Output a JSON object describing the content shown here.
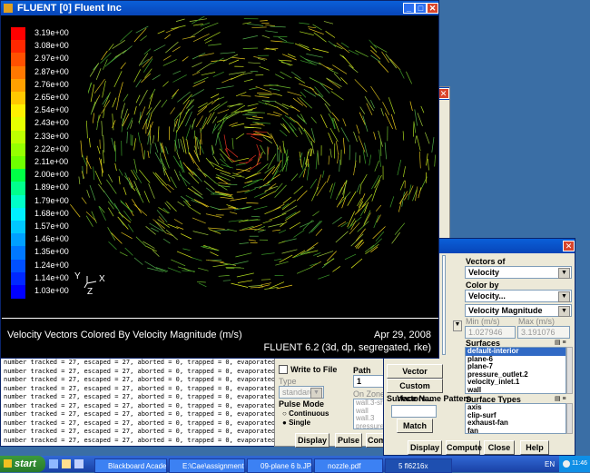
{
  "fluent_window": {
    "title": "FLUENT [0] Fluent Inc",
    "legend": [
      "3.19e+00",
      "3.08e+00",
      "2.97e+00",
      "2.87e+00",
      "2.76e+00",
      "2.65e+00",
      "2.54e+00",
      "2.43e+00",
      "2.33e+00",
      "2.22e+00",
      "2.11e+00",
      "2.00e+00",
      "1.89e+00",
      "1.79e+00",
      "1.68e+00",
      "1.57e+00",
      "1.46e+00",
      "1.35e+00",
      "1.24e+00",
      "1.14e+00",
      "1.03e+00"
    ],
    "legend_colors": [
      "#ff0000",
      "#ff2800",
      "#ff5000",
      "#ff7800",
      "#ffa000",
      "#ffc800",
      "#fff000",
      "#e6ff00",
      "#beff00",
      "#96ff00",
      "#6eff00",
      "#00ff46",
      "#00ff8c",
      "#00ffc8",
      "#00f0ff",
      "#00c8ff",
      "#00a0ff",
      "#0078ff",
      "#0050ff",
      "#0028ff",
      "#0000ff"
    ],
    "axis_y": "Y",
    "axis_x": "X",
    "axis_z": "Z",
    "caption": "Velocity Vectors Colored By Velocity Magnitude (m/s)",
    "date": "Apr 29, 2008",
    "version": "FLUENT 6.2 (3d, dp, segregated, rke)"
  },
  "console": {
    "lines": [
      "number tracked = 27, escaped = 27, aborted = 0, trapped = 0, evaporated = 0",
      "number tracked = 27, escaped = 27, aborted = 0, trapped = 0, evaporated = 0",
      "number tracked = 27, escaped = 27, aborted = 0, trapped = 0, evaporated = 0",
      "number tracked = 27, escaped = 27, aborted = 0, trapped = 0, evaporated = 0",
      "number tracked = 27, escaped = 27, aborted = 0, trapped = 0, evaporated = 0",
      "number tracked = 27, escaped = 27, aborted = 0, trapped = 0, evaporated = 0",
      "number tracked = 27, escaped = 27, aborted = 0, trapped = 0, evaporated = 0",
      "number tracked = 27, escaped = 27, aborted = 0, trapped = 0, evaporated = 0",
      "number tracked = 27, escaped = 27, aborted = 0, trapped = 0, evaporated = 0",
      "number tracked = 27, escaped = 27, aborted = 0, trapped = 0, evaporated = 0"
    ]
  },
  "pathlines_dialog": {
    "write_to_file": "Write to File",
    "type_label": "Type",
    "type_value": "standard",
    "pulse_mode_label": "Pulse Mode",
    "continuous": "Continuous",
    "single": "Single",
    "path_coarsen_label": "Path Coar",
    "path_coarsen_value": "1",
    "on_zone_label": "On Zone",
    "on_zone_items": [
      "wall.3-sh",
      "wall",
      "wall.3",
      "pressure"
    ],
    "display_button": "Display",
    "pulse_button": "Pulse",
    "compute_button": "Com"
  },
  "vectors_dialog": {
    "vector_options_button": "Vector Options...",
    "custom_vectors_button": "Custom Vectors...",
    "surface_name_pattern_label": "Surface Name Pattern",
    "surface_name_pattern_value": "",
    "match_button": "Match",
    "vectors_of_label": "Vectors of",
    "vectors_of_value": "Velocity",
    "color_by_label": "Color by",
    "color_by_value": "Velocity...",
    "color_by_sub_value": "Velocity Magnitude",
    "min_label": "Min (m/s)",
    "min_value": "1.027946",
    "max_label": "Max (m/s)",
    "max_value": "3.191076",
    "surfaces_label": "Surfaces",
    "surfaces": [
      "default-interior",
      "plane-6",
      "plane-7",
      "pressure_outlet.2",
      "velocity_inlet.1",
      "wall"
    ],
    "surface_types_label": "Surface Types",
    "surface_types": [
      "axis",
      "clip-surf",
      "exhaust-fan",
      "fan"
    ],
    "display_button": "Display",
    "compute_button": "Compute",
    "close_button": "Close",
    "help_button": "Help"
  },
  "taskbar": {
    "start": "start",
    "tasks": [
      "Blackboard Academic ...",
      "E:\\Cae\\assignment 2 ...",
      "09-plane 6 b.JPG - Paint",
      "nozzle.pdf",
      "5 fl6216x"
    ],
    "lang": "EN",
    "clock": "11:46"
  }
}
